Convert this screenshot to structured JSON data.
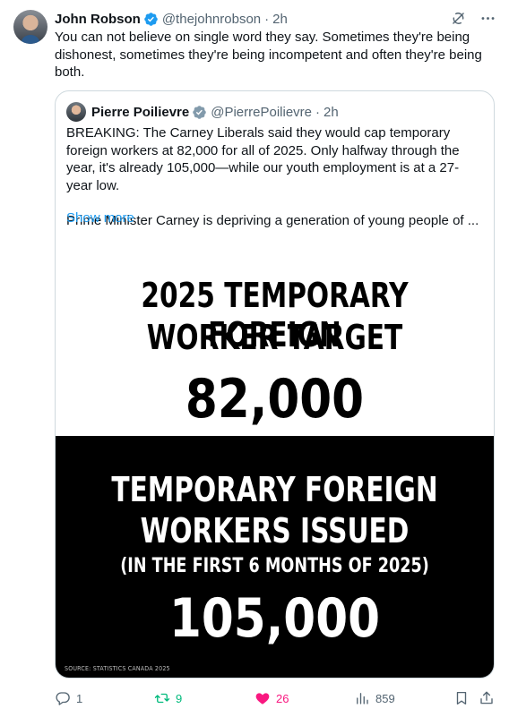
{
  "tweet": {
    "author_name": "John Robson",
    "author_handle": "@thejohnrobson",
    "time": "2h",
    "separator": "·",
    "text": "You can not believe on single word they say. Sometimes they're being dishonest, sometimes they're being incompetent and often they're being both."
  },
  "quote": {
    "author_name": "Pierre Poilievre",
    "author_handle": "@PierrePoilievre",
    "time": "2h",
    "separator": "·",
    "paragraph1": "BREAKING: The Carney Liberals said they would cap temporary foreign workers at 82,000 for all of 2025. Only halfway through the year, it's already 105,000—while our youth employment is at a 27-year low.",
    "paragraph2": "Prime Minister Carney is depriving a generation of young people of ...",
    "show_more": "Show more"
  },
  "graphic": {
    "top_title_line1": "2025 TEMPORARY FOREIGN",
    "top_title_line2": "WORKER TARGET",
    "top_value": "82,000",
    "bottom_title_line1": "TEMPORARY FOREIGN",
    "bottom_title_line2": "WORKERS ISSUED",
    "bottom_subtitle": "(IN THE FIRST 6 MONTHS OF 2025)",
    "bottom_value": "105,000",
    "source": "SOURCE: STATISTICS CANADA 2025"
  },
  "actions": {
    "replies": "1",
    "reposts": "9",
    "likes": "26",
    "views": "859"
  },
  "icons": {
    "verified": "verified-badge-icon",
    "gray_check": "government-badge-icon",
    "grok": "grok-icon",
    "more": "more-icon",
    "reply": "reply-icon",
    "repost": "repost-icon",
    "like": "heart-icon",
    "views": "views-icon",
    "bookmark": "bookmark-icon",
    "share": "share-icon"
  },
  "colors": {
    "accent": "#1d9bf0",
    "repost_active": "#00ba7c",
    "like_active": "#f91880",
    "muted": "#536471"
  }
}
